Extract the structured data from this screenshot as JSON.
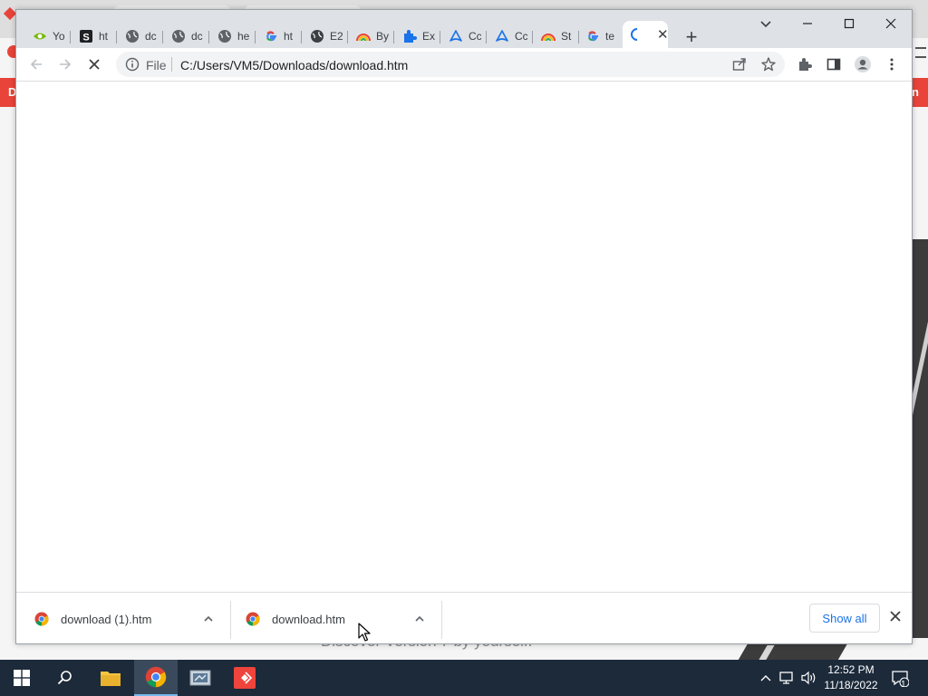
{
  "background_page": {
    "red_band_left": "D",
    "red_band_right": "n",
    "footer_text": "Discover Version 7 by yourself."
  },
  "tabs": [
    {
      "label": "Yo",
      "icon": "nvidia-icon",
      "color": "#76b900"
    },
    {
      "label": "ht",
      "icon": "s-logo-icon",
      "color": "#202124"
    },
    {
      "label": "dc",
      "icon": "globe-icon",
      "color": "#5f6368"
    },
    {
      "label": "dc",
      "icon": "globe-icon",
      "color": "#5f6368"
    },
    {
      "label": "he",
      "icon": "globe-icon",
      "color": "#5f6368"
    },
    {
      "label": "ht",
      "icon": "google-icon",
      "color": "#4285f4"
    },
    {
      "label": "E2",
      "icon": "globe-dark-icon",
      "color": "#3c4043"
    },
    {
      "label": "By",
      "icon": "rainbow-icon",
      "color": "#e8443a"
    },
    {
      "label": "Ex",
      "icon": "puzzle-icon",
      "color": "#1a73e8"
    },
    {
      "label": "Cc",
      "icon": "acrobat-icon",
      "color": "#1a73e8"
    },
    {
      "label": "Cc",
      "icon": "acrobat-icon",
      "color": "#1a73e8"
    },
    {
      "label": "St",
      "icon": "rainbow-icon",
      "color": "#e8443a"
    },
    {
      "label": "te",
      "icon": "google-icon",
      "color": "#4285f4"
    }
  ],
  "active_tab": {
    "icon": "loading-spinner-icon",
    "close": "✕"
  },
  "new_tab": "+",
  "toolbar": {
    "scheme_label": "File",
    "url": "C:/Users/VM5/Downloads/download.htm"
  },
  "downloads": [
    {
      "name": "download (1).htm"
    },
    {
      "name": "download.htm"
    }
  ],
  "show_all": "Show all",
  "taskbar": {
    "time": "12:52 PM",
    "date": "11/18/2022",
    "notifications": "1"
  },
  "colors": {
    "accent": "#1a73e8",
    "titlebar": "#dee1e6",
    "taskbar": "#1c2a3a",
    "bg_red": "#e8443a"
  }
}
